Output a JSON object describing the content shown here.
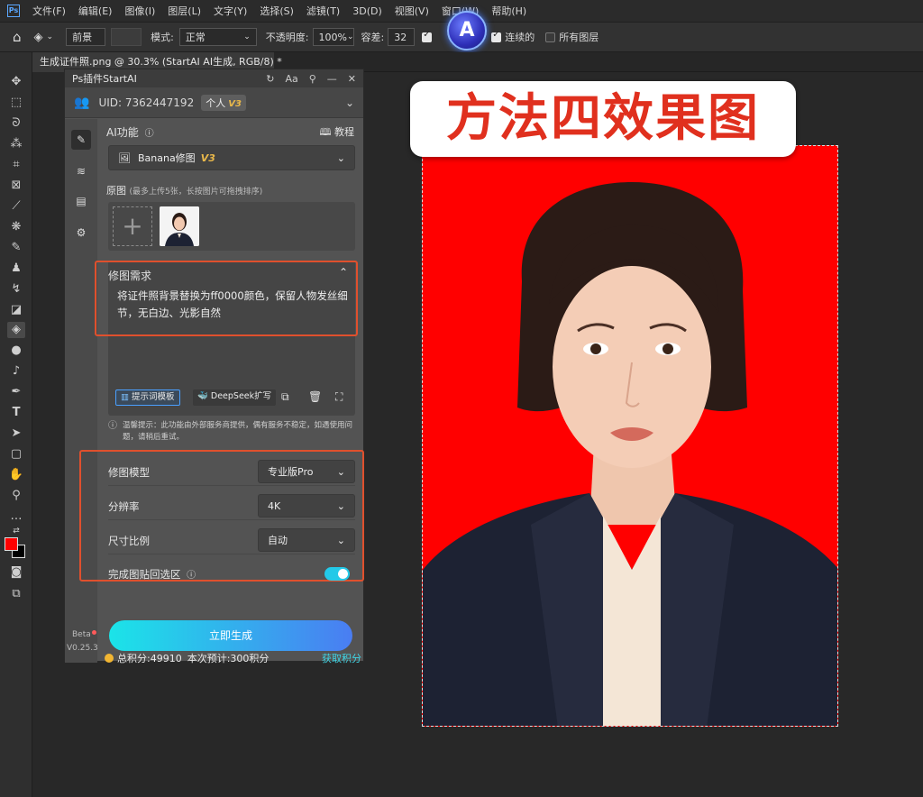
{
  "menubar": {
    "logo": "Ps",
    "items": [
      "文件(F)",
      "编辑(E)",
      "图像(I)",
      "图层(L)",
      "文字(Y)",
      "选择(S)",
      "滤镜(T)",
      "3D(D)",
      "视图(V)",
      "窗口(W)",
      "帮助(H)"
    ]
  },
  "options": {
    "foreground": "前景",
    "mode_label": "模式:",
    "mode_value": "正常",
    "opacity_label": "不透明度:",
    "opacity_value": "100%",
    "tolerance_label": "容差:",
    "tolerance_value": "32",
    "contiguous": "连续的",
    "all_layers": "所有图层"
  },
  "doc": {
    "tab_title": "生成证件照.png @ 30.3% (StartAI AI生成, RGB/8) *"
  },
  "overlay": {
    "title": "方法四效果图",
    "badge_letter": "A"
  },
  "panel": {
    "title": "Ps插件StartAI",
    "uid": "UID: 7362447192",
    "account_type": "个人",
    "version_tag": "V3",
    "ai_function_label": "AI功能",
    "tutorial_label": "教程",
    "function_value": "Banana修图",
    "source_label": "原图",
    "source_hint": "(最多上传5张，长按图片可拖拽排序)",
    "requirement_label": "修图需求",
    "requirement_text": "将证件照背景替换为ff0000颜色，保留人物发丝细节，无白边、光影自然",
    "prompt_template": "提示词模板",
    "deepseek": "DeepSeek扩写",
    "warm_tip": "温馨提示：此功能由外部服务商提供，偶有服务不稳定，如遇使用问题，请稍后重试。",
    "settings": [
      {
        "label": "修图模型",
        "value": "专业版Pro"
      },
      {
        "label": "分辨率",
        "value": "4K"
      },
      {
        "label": "尺寸比例",
        "value": "自动"
      }
    ],
    "paste_back_label": "完成图贴回选区",
    "points_total": "总积分:49910",
    "points_estimate": "本次预计:300积分",
    "get_points": "获取积分",
    "beta": "Beta",
    "version": "V0.25.3",
    "generate": "立即生成"
  },
  "colors": {
    "accent": "#23c9e8",
    "title_red": "#e0301e",
    "background_red": "#ff0000",
    "frame_orange": "#e0502d"
  }
}
